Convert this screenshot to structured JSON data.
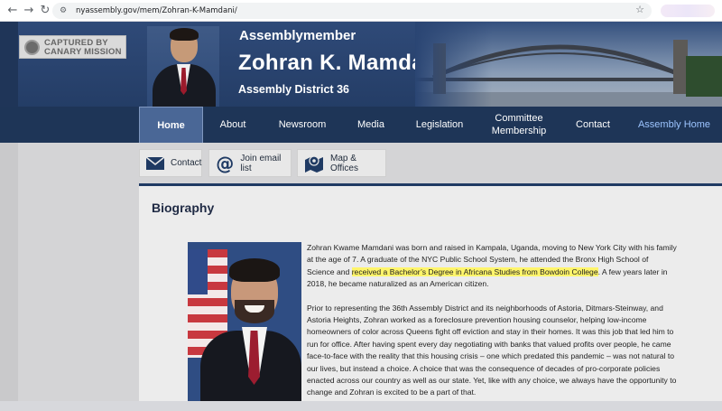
{
  "browser": {
    "url": "nyassembly.gov/mem/Zohran-K-Mamdani/",
    "back_icon": "arrow-left",
    "forward_icon": "arrow-right",
    "reload_icon": "reload",
    "bookmark_icon": "star"
  },
  "header": {
    "watermark": "CAPTURED BY CANARY MISSION",
    "role": "Assemblymember",
    "name": "Zohran K. Mamdani",
    "district": "Assembly District 36"
  },
  "nav": {
    "items": [
      {
        "label": "Home"
      },
      {
        "label": "About"
      },
      {
        "label": "Newsroom"
      },
      {
        "label": "Media"
      },
      {
        "label": "Legislation"
      },
      {
        "label": "Committee Membership"
      },
      {
        "label": "Contact"
      },
      {
        "label": "Assembly Home"
      }
    ],
    "active": "Home"
  },
  "subnav": {
    "contact": {
      "label": "Contact",
      "icon": "envelope-icon"
    },
    "email": {
      "label": "Join email list",
      "icon": "at-sign-icon"
    },
    "map": {
      "label": "Map & Offices",
      "icon": "map-pin-icon"
    }
  },
  "biography": {
    "heading": "Biography",
    "p1_before": "Zohran Kwame Mamdani was born and raised in Kampala, Uganda, moving to New York City with his family at the age of 7. A graduate of the NYC Public School System, he attended the Bronx High School of Science and ",
    "p1_highlight": "received a Bachelor’s Degree in Africana Studies from Bowdoin College",
    "p1_after": ". A few years later in 2018, he became naturalized as an American citizen.",
    "p2": "Prior to representing the 36th Assembly District and its neighborhoods of Astoria, Ditmars-Steinway, and Astoria Heights, Zohran worked as a foreclosure prevention housing counselor, helping low-income homeowners of color across Queens fight off eviction and stay in their homes. It was this job that led him to run for office. After having spent every day negotiating with banks that valued profits over people, he came face-to-face with the reality that this housing crisis – one which predated this pandemic – was not natural to our lives, but instead a choice. A choice that was the consequence of decades of pro-corporate policies enacted across our country as well as our state. Yet, like with any choice, we always have the opportunity to change and Zohran is excited to be a part of that."
  },
  "colors": {
    "navy": "#1e3557",
    "active_tab": "#4a6796",
    "highlight": "#fff56b"
  }
}
